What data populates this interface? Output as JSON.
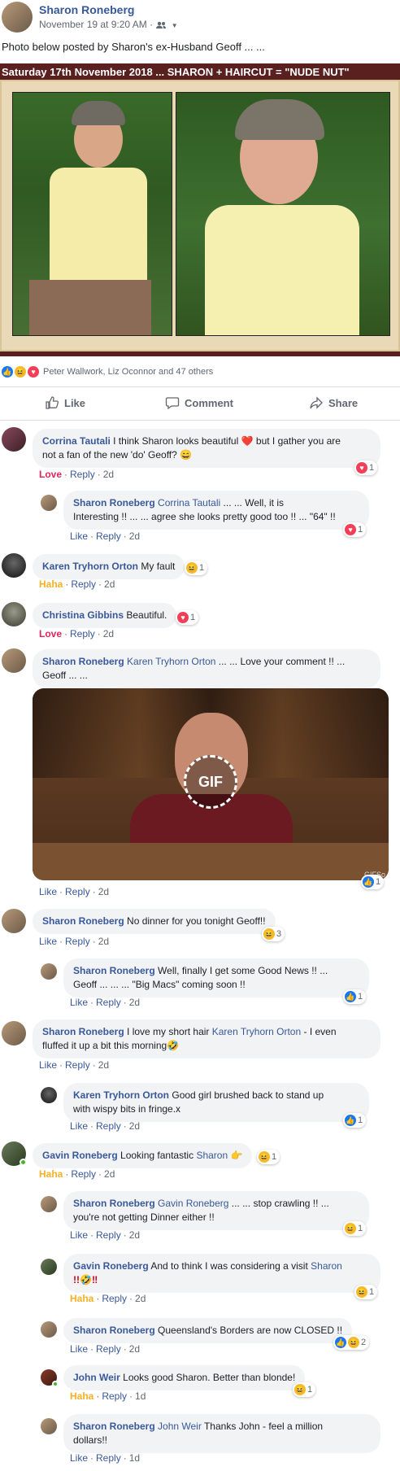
{
  "post": {
    "author": "Sharon Roneberg",
    "timestamp": "November 19 at 9:20 AM",
    "privacy_icon": "friends-icon",
    "text": "Photo below posted by Sharon's ex-Husband Geoff ... ...",
    "banner": "Saturday 17th November 2018 ... SHARON  +  HAIRCUT = \"NUDE  NUT\"",
    "reactions_summary": "Peter Wallwork, Liz Oconnor and 47 others",
    "buttons": {
      "like": "Like",
      "comment": "Comment",
      "share": "Share"
    }
  },
  "labels": {
    "like": "Like",
    "reply": "Reply",
    "love": "Love",
    "haha": "Haha",
    "gif": "GIF",
    "gif_watermark": "GIFSo"
  },
  "comments": [
    {
      "author": "Corrina Tautali",
      "text1": "I think Sharon looks beautiful",
      "text2": "but I gather you are",
      "text3": "not a fan of the new 'do' Geoff?",
      "reaction": "Love",
      "time": "2d",
      "count": "1"
    },
    {
      "author": "Sharon Roneberg",
      "mention": "Corrina Tautali",
      "text1": "... ... Well, it is",
      "text2": "Interesting !! ... ... agree she looks pretty good too !! ... \"64\" !!",
      "time": "2d",
      "count": "1"
    },
    {
      "author": "Karen Tryhorn Orton",
      "text1": "My fault",
      "reaction": "Haha",
      "time": "2d",
      "count": "1"
    },
    {
      "author": "Christina Gibbins",
      "text1": "Beautiful.",
      "reaction": "Love",
      "time": "2d",
      "count": "1"
    },
    {
      "author": "Sharon Roneberg",
      "mention": "Karen Tryhorn Orton",
      "text1": "... ... Love your comment !! ...",
      "text2": "Geoff ... ...",
      "time": "2d",
      "count": "1"
    },
    {
      "author": "Sharon Roneberg",
      "text1": "No dinner for you tonight Geoff!!",
      "time": "2d",
      "count": "3"
    },
    {
      "author": "Sharon Roneberg",
      "text1": "Well, finally I get some Good News !! ...",
      "text2": "Geoff ... ... ... \"Big Macs\" coming soon !!",
      "time": "2d",
      "count": "1"
    },
    {
      "author": "Sharon Roneberg",
      "text1": "I love my short hair",
      "mention": "Karen Tryhorn Orton",
      "text2": "- I even",
      "text3": "fluffed it up a bit this morning",
      "time": "2d"
    },
    {
      "author": "Karen Tryhorn Orton",
      "text1": "Good girl brushed back to stand up",
      "text2": "with wispy bits in fringe.x",
      "time": "2d",
      "count": "1"
    },
    {
      "author": "Gavin Roneberg",
      "text1": "Looking fantastic",
      "mention": "Sharon",
      "reaction": "Haha",
      "time": "2d",
      "count": "1"
    },
    {
      "author": "Sharon Roneberg",
      "mention": "Gavin Roneberg",
      "text1": "... ... stop crawling !! ...",
      "text2": "you're not getting Dinner either !!",
      "time": "2d",
      "count": "1"
    },
    {
      "author": "Gavin Roneberg",
      "text1": "And to think I was considering a visit",
      "mention": "Sharon",
      "text2": "!!",
      "reaction": "Haha",
      "time": "2d",
      "count": "1"
    },
    {
      "author": "Sharon Roneberg",
      "text1": "Queensland's Borders are now CLOSED !!",
      "time": "2d",
      "count": "2"
    },
    {
      "author": "John Weir",
      "text1": "Looks good Sharon. Better than blonde!",
      "reaction": "Haha",
      "time": "1d",
      "count": "1"
    },
    {
      "author": "Sharon Roneberg",
      "mention": "John Weir",
      "text1": "Thanks John - feel a million",
      "text2": "dollars!!",
      "time": "1d"
    }
  ],
  "colors": {
    "link": "#385898",
    "love": "#e0245e",
    "haha": "#f7b125",
    "like": "#1877f2",
    "bubble": "#f2f3f5"
  }
}
